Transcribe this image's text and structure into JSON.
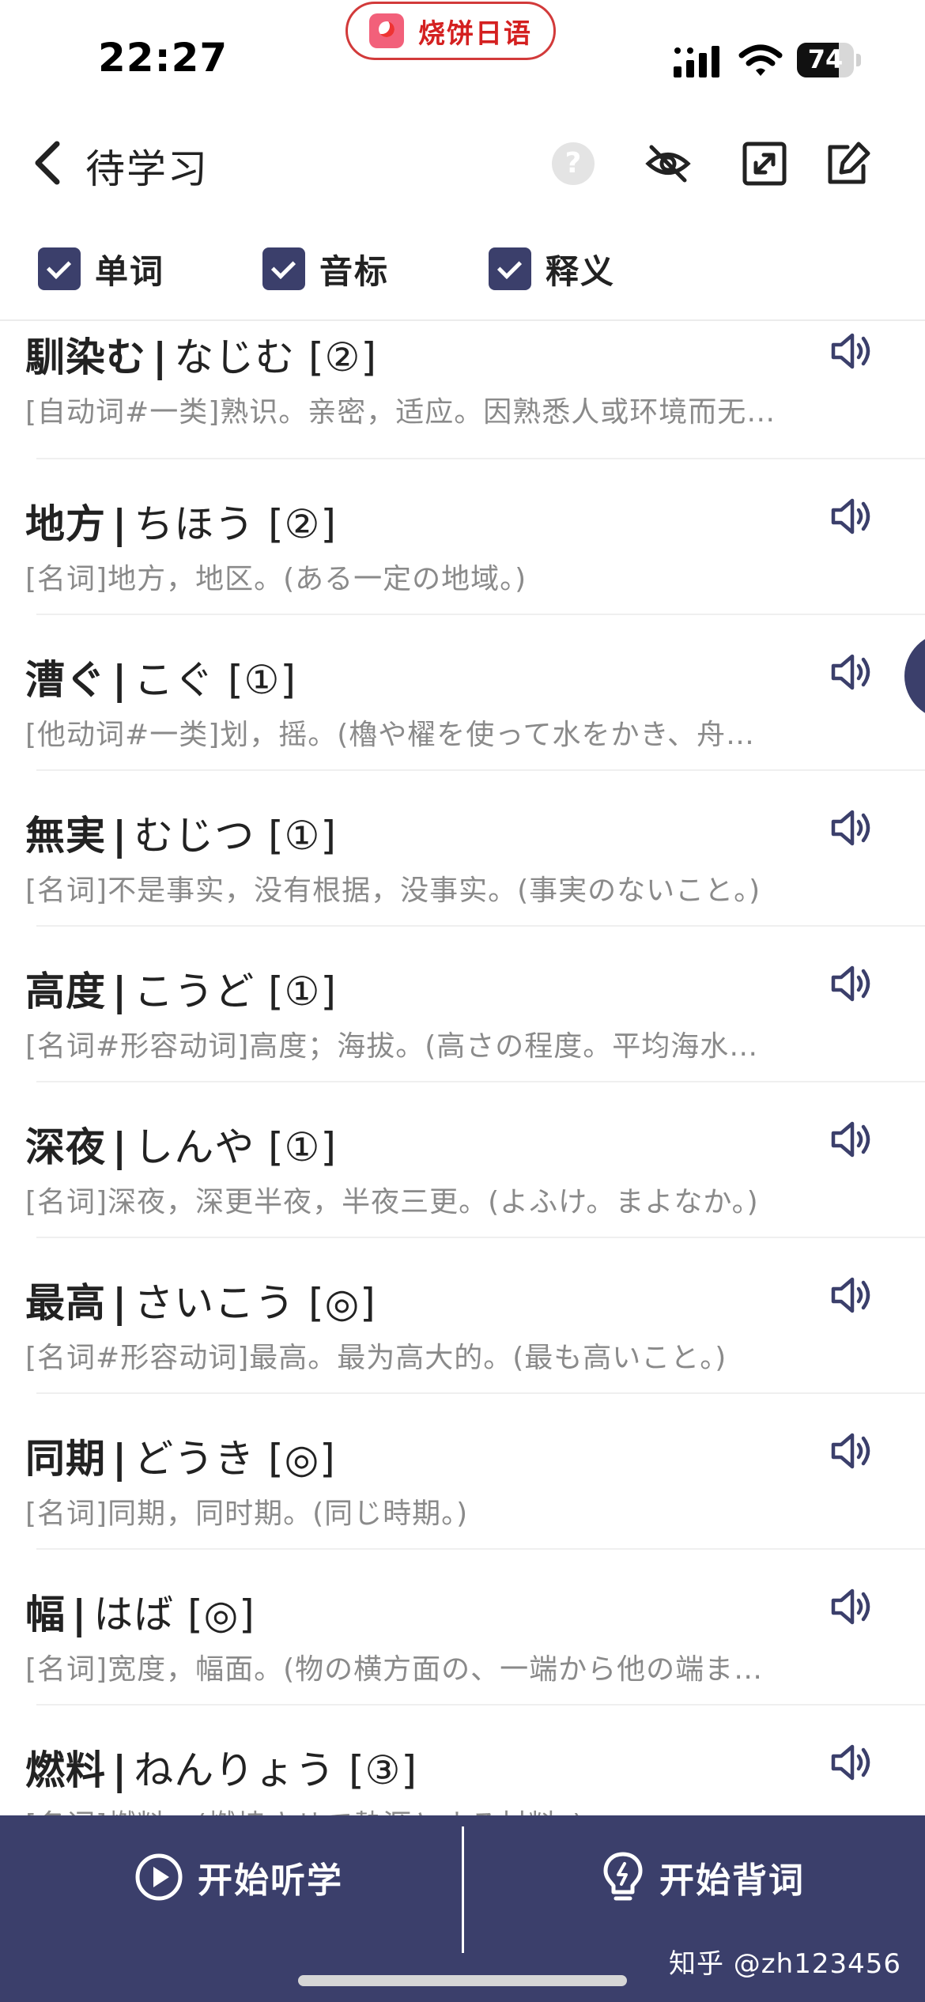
{
  "status": {
    "time": "22:27",
    "app_name": "烧饼日语",
    "battery_level": "74",
    "battery_fraction": 0.74
  },
  "nav": {
    "title": "待学习",
    "help_glyph": "?",
    "icons": [
      "back-chevron-icon",
      "help-icon",
      "eye-hidden-icon",
      "expand-icon",
      "edit-icon"
    ]
  },
  "filters": [
    {
      "label": "单词",
      "checked": true
    },
    {
      "label": "音标",
      "checked": true
    },
    {
      "label": "释义",
      "checked": true
    }
  ],
  "words": [
    {
      "term": "馴染む",
      "reading": "なじむ",
      "accent": "[②]",
      "definition": "[自动词#一类]熟识。亲密，适应。因熟悉人或环境而无…"
    },
    {
      "term": "地方",
      "reading": "ちほう",
      "accent": "[②]",
      "definition": "[名词]地方，地区。(ある一定の地域。)"
    },
    {
      "term": "漕ぐ",
      "reading": "こぐ",
      "accent": "[①]",
      "definition": "[他动词#一类]划，摇。(櫓や櫂を使って水をかき、舟…"
    },
    {
      "term": "無実",
      "reading": "むじつ",
      "accent": "[①]",
      "definition": "[名词]不是事实，没有根据，没事实。(事実のないこと。)"
    },
    {
      "term": "高度",
      "reading": "こうど",
      "accent": "[①]",
      "definition": "[名词#形容动词]高度；海拔。(高さの程度。平均海水…"
    },
    {
      "term": "深夜",
      "reading": "しんや",
      "accent": "[①]",
      "definition": "[名词]深夜，深更半夜，半夜三更。(よふけ。まよなか。)"
    },
    {
      "term": "最高",
      "reading": "さいこう",
      "accent": "[◎]",
      "definition": "[名词#形容动词]最高。最为高大的。(最も高いこと。)"
    },
    {
      "term": "同期",
      "reading": "どうき",
      "accent": "[◎]",
      "definition": "[名词]同期，同时期。(同じ時期。)"
    },
    {
      "term": "幅",
      "reading": "はば",
      "accent": "[◎]",
      "definition": "[名词]宽度，幅面。(物の横方面の、一端から他の端ま…"
    },
    {
      "term": "燃料",
      "reading": "ねんりょう",
      "accent": "[③]",
      "definition": "[名词]燃料。(燃焼させて熱源とする材料。)"
    }
  ],
  "bottom": {
    "listen_label": "开始听学",
    "memorize_label": "开始背词",
    "watermark": "知乎 @zh123456"
  },
  "colors": {
    "primary": "#3b3f6b",
    "accent_red": "#d42020",
    "definition_gray": "#8a8a8a"
  }
}
